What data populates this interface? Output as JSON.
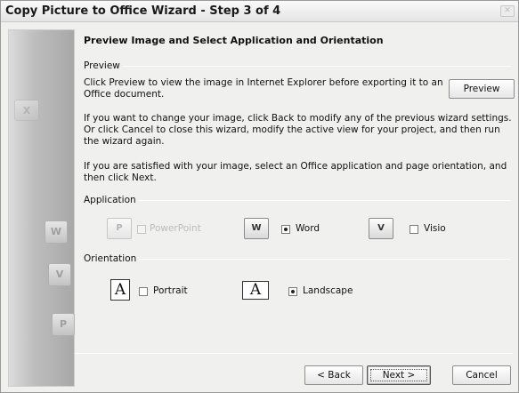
{
  "window": {
    "title": "Copy Picture to Office Wizard - Step 3 of 4",
    "close_label": "✕"
  },
  "sidebar": {
    "icons": [
      "excel-icon",
      "word-icon",
      "visio-icon",
      "project-icon"
    ]
  },
  "heading": "Preview Image and Select Application and Orientation",
  "preview": {
    "group_label": "Preview",
    "text": "Click Preview to view the image in Internet Explorer before exporting it to an Office document.",
    "button_label": "Preview"
  },
  "instructions": {
    "change": "If you want to change your image, click Back to modify any of the previous wizard settings. Or click Cancel to close this wizard, modify the active view for your project, and then run the wizard again.",
    "satisfied": "If you are satisfied with your image, select an Office application and page orientation, and then click Next."
  },
  "application": {
    "group_label": "Application",
    "options": [
      {
        "label": "PowerPoint",
        "icon": "powerpoint-icon",
        "selected": false,
        "disabled": true
      },
      {
        "label": "Word",
        "icon": "word-icon",
        "selected": true,
        "disabled": false
      },
      {
        "label": "Visio",
        "icon": "visio-icon",
        "selected": false,
        "disabled": false
      }
    ]
  },
  "orientation": {
    "group_label": "Orientation",
    "options": [
      {
        "label": "Portrait",
        "icon": "portrait-icon",
        "selected": false
      },
      {
        "label": "Landscape",
        "icon": "landscape-icon",
        "selected": true
      }
    ]
  },
  "footer": {
    "back_label": "< Back",
    "next_label": "Next >",
    "cancel_label": "Cancel"
  }
}
